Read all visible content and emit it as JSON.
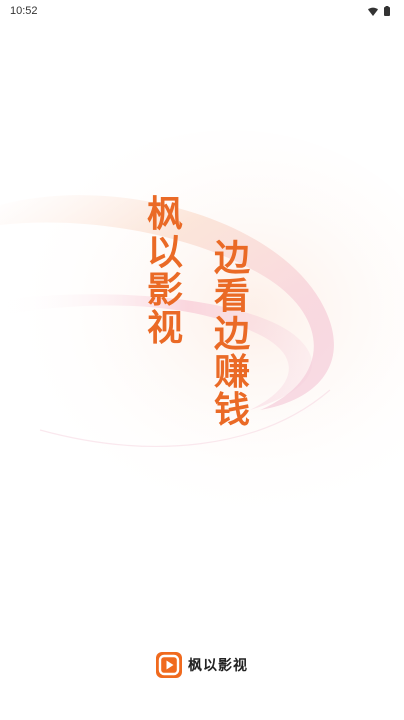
{
  "status_bar": {
    "time": "10:52",
    "icons": [
      "wifi-icon",
      "battery-icon"
    ]
  },
  "slogan": {
    "left_column": [
      "枫",
      "以",
      "影",
      "视"
    ],
    "right_column": [
      "边",
      "看",
      "边",
      "赚",
      "钱"
    ]
  },
  "brand": {
    "logo_icon": "play-logo-icon",
    "name": "枫以影视"
  },
  "colors": {
    "accent": "#ea6a26",
    "logo_orange": "#f06a1e",
    "swoosh_pink": "#f7c6d6",
    "swoosh_peach": "#fbe3d6"
  }
}
